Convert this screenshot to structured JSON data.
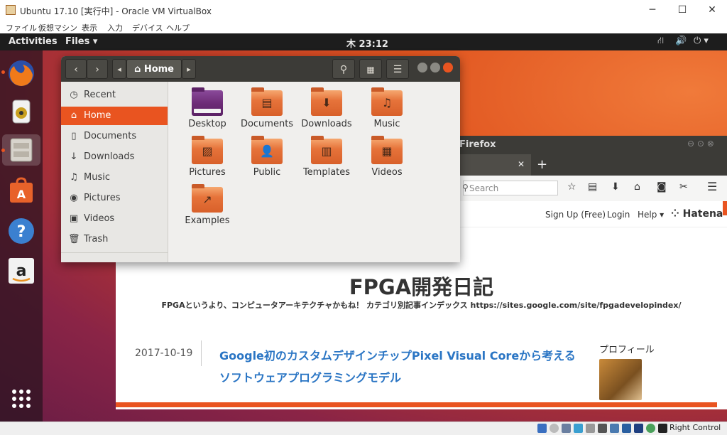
{
  "host_window": {
    "title": "Ubuntu 17.10 [実行中] - Oracle VM VirtualBox",
    "controls": {
      "minimize": "─",
      "maximize": "☐",
      "close": "✕"
    },
    "menu": [
      "ファイル",
      "仮想マシン",
      "表示",
      "入力",
      "デバイス",
      "ヘルプ"
    ],
    "status_host_key": "Right Control"
  },
  "topbar": {
    "activities": "Activities",
    "app_menu": "Files ▾",
    "clock": "木 23:12",
    "indicators": {
      "network": "network-icon",
      "volume": "volume-icon",
      "power": "power-icon"
    }
  },
  "dock": [
    "firefox-icon",
    "rhythmbox-icon",
    "files-icon",
    "software-center-icon",
    "help-icon",
    "amazon-icon",
    "show-apps-icon"
  ],
  "files_window": {
    "path_label": "Home",
    "sidebar": [
      {
        "label": "Recent",
        "icon": "◷"
      },
      {
        "label": "Home",
        "icon": "⌂",
        "selected": true
      },
      {
        "label": "Documents",
        "icon": "▯"
      },
      {
        "label": "Downloads",
        "icon": "↓"
      },
      {
        "label": "Music",
        "icon": "♫"
      },
      {
        "label": "Pictures",
        "icon": "◉"
      },
      {
        "label": "Videos",
        "icon": "▣"
      },
      {
        "label": "Trash",
        "icon": "🗑"
      }
    ],
    "folders": [
      {
        "label": "Desktop",
        "glyph": ""
      },
      {
        "label": "Documents",
        "glyph": "▤"
      },
      {
        "label": "Downloads",
        "glyph": "⬇"
      },
      {
        "label": "Music",
        "glyph": "♫"
      },
      {
        "label": "Pictures",
        "glyph": "▨"
      },
      {
        "label": "Public",
        "glyph": "👤"
      },
      {
        "label": "Templates",
        "glyph": "▥"
      },
      {
        "label": "Videos",
        "glyph": "▦"
      },
      {
        "label": "Examples",
        "glyph": "↗"
      }
    ]
  },
  "firefox_window": {
    "title_fragment": "Firefox",
    "tab_close": "✕",
    "new_tab": "+",
    "search_placeholder": "Search",
    "hatena_links": [
      "Sign Up (Free)",
      "Login",
      "Help ▾"
    ],
    "hatena_logo": "Hatena",
    "blog_title": "FPGA開発日記",
    "blog_description": "FPGAというより、コンピュータアーキテクチャかもね！ カテゴリ別記事インデックス https://sites.google.com/site/fpgadevelopindex/",
    "post_date": "2017-10-19",
    "post_title_line1": "Google初のカスタムデザインチップPixel Visual Coreから考える",
    "post_title_line2": "ソフトウェアプログラミングモデル",
    "profile_label": "プロフィール"
  }
}
